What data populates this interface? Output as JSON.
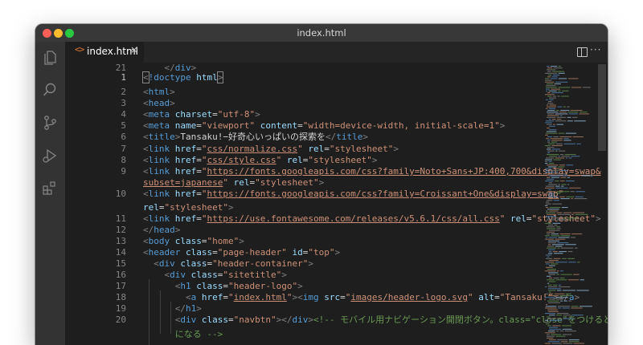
{
  "window": {
    "title": "index.html"
  },
  "tab": {
    "icon": "<>",
    "label": "index.html",
    "close": "×"
  },
  "toolbar": {
    "more": "···"
  },
  "activity": [
    "files-icon",
    "search-icon",
    "source-control-icon",
    "run-debug-icon",
    "extensions-icon"
  ],
  "lines": [
    {
      "n": "1",
      "html": "<span class=\"g cursorbox\">&lt;</span><span class=\"t\">!doctype</span> <span class=\"a\">html</span><span class=\"g cursorbox\">&gt;</span>"
    },
    {
      "n": "2",
      "html": "<span class=\"g\">&lt;</span><span class=\"t\">html</span><span class=\"g\">&gt;</span>"
    },
    {
      "n": "3",
      "html": "<span class=\"g\">&lt;</span><span class=\"t\">head</span><span class=\"g\">&gt;</span>"
    },
    {
      "n": "4",
      "html": "<span class=\"g\">&lt;</span><span class=\"t\">meta</span> <span class=\"a\">charset</span>=<span class=\"s\">\"utf-8\"</span><span class=\"g\">&gt;</span>"
    },
    {
      "n": "5",
      "html": "<span class=\"g\">&lt;</span><span class=\"t\">meta</span> <span class=\"a\">name</span>=<span class=\"s\">\"viewport\"</span> <span class=\"a\">content</span>=<span class=\"s\">\"width=device-width, initial-scale=1\"</span><span class=\"g\">&gt;</span>"
    },
    {
      "n": "6",
      "html": "<span class=\"g\">&lt;</span><span class=\"t\">title</span><span class=\"g\">&gt;</span><span class=\"x\">Tansaku!−好奇心いっぱいの探索を</span><span class=\"g\">&lt;/</span><span class=\"t\">title</span><span class=\"g\">&gt;</span>"
    },
    {
      "n": "7",
      "html": "<span class=\"g\">&lt;</span><span class=\"t\">link</span> <span class=\"a\">href</span>=<span class=\"s\">\"<span class=\"u\">css/normalize.css</span>\"</span> <span class=\"a\">rel</span>=<span class=\"s\">\"stylesheet\"</span><span class=\"g\">&gt;</span>"
    },
    {
      "n": "8",
      "html": "<span class=\"g\">&lt;</span><span class=\"t\">link</span> <span class=\"a\">href</span>=<span class=\"s\">\"<span class=\"u\">css/style.css</span>\"</span> <span class=\"a\">rel</span>=<span class=\"s\">\"stylesheet\"</span><span class=\"g\">&gt;</span>"
    },
    {
      "n": "9",
      "html": "<span class=\"g\">&lt;</span><span class=\"t\">link</span> <span class=\"a\">href</span>=<span class=\"s\">\"<span class=\"u\">https://fonts.googleapis.com/css?family=Noto+Sans+JP:400,700&amp;display=swap&amp;</span></span>"
    },
    {
      "n": "",
      "html": "<span class=\"s\"><span class=\"u\">subset=japanese</span>\"</span> <span class=\"a\">rel</span>=<span class=\"s\">\"stylesheet\"</span><span class=\"g\">&gt;</span>"
    },
    {
      "n": "10",
      "html": "<span class=\"g\">&lt;</span><span class=\"t\">link</span> <span class=\"a\">href</span>=<span class=\"s\">\"<span class=\"u\">https://fonts.googleapis.com/css?family=Croissant+One&amp;display=swap</span>\"</span>"
    },
    {
      "n": "",
      "html": "<span class=\"a\">rel</span>=<span class=\"s\">\"stylesheet\"</span><span class=\"g\">&gt;</span>"
    },
    {
      "n": "11",
      "html": "<span class=\"g\">&lt;</span><span class=\"t\">link</span> <span class=\"a\">href</span>=<span class=\"s\">\"<span class=\"u\">https://use.fontawesome.com/releases/v5.6.1/css/all.css</span>\"</span> <span class=\"a\">rel</span>=<span class=\"s\">\"stylesheet\"</span><span class=\"g\">&gt;</span>"
    },
    {
      "n": "12",
      "html": "<span class=\"g\">&lt;/</span><span class=\"t\">head</span><span class=\"g\">&gt;</span>"
    },
    {
      "n": "13",
      "html": "<span class=\"g\">&lt;</span><span class=\"t\">body</span> <span class=\"a\">class</span>=<span class=\"s\">\"home\"</span><span class=\"g\">&gt;</span>"
    },
    {
      "n": "14",
      "html": "<span class=\"g\">&lt;</span><span class=\"t\">header</span> <span class=\"a\">class</span>=<span class=\"s\">\"page-header\"</span> <span class=\"a\">id</span>=<span class=\"s\">\"top\"</span><span class=\"g\">&gt;</span>"
    },
    {
      "n": "15",
      "html": "  <span class=\"g\">&lt;</span><span class=\"t\">div</span> <span class=\"a\">class</span>=<span class=\"s\">\"header-container\"</span><span class=\"g\">&gt;</span>"
    },
    {
      "n": "16",
      "html": "    <span class=\"g\">&lt;</span><span class=\"t\">div</span> <span class=\"a\">class</span>=<span class=\"s\">\"sitetitle\"</span><span class=\"g\">&gt;</span>"
    },
    {
      "n": "17",
      "html": "      <span class=\"g\">&lt;</span><span class=\"t\">h1</span> <span class=\"a\">class</span>=<span class=\"s\">\"header-logo\"</span><span class=\"g\">&gt;</span>"
    },
    {
      "n": "18",
      "html": "        <span class=\"g\">&lt;</span><span class=\"t\">a</span> <span class=\"a\">href</span>=<span class=\"s\">\"<span class=\"u\">index.html</span>\"</span><span class=\"g\">&gt;&lt;</span><span class=\"t\">img</span> <span class=\"a\">src</span>=<span class=\"s\">\"<span class=\"u\">images/header-logo.svg</span>\"</span> <span class=\"a\">alt</span>=<span class=\"s\">\"Tansaku!\"</span><span class=\"g\">&gt;&lt;/</span><span class=\"t\">a</span><span class=\"g\">&gt;</span>"
    },
    {
      "n": "19",
      "html": "      <span class=\"g\">&lt;/</span><span class=\"t\">h1</span><span class=\"g\">&gt;</span>"
    },
    {
      "n": "20",
      "html": "      <span class=\"g\">&lt;</span><span class=\"t\">div</span> <span class=\"a\">class</span>=<span class=\"s\">\"navbtn\"</span><span class=\"g\">&gt;&lt;/</span><span class=\"t\">div</span><span class=\"g\">&gt;</span><span class=\"c\">&lt;!-- モバイル用ナビゲーション開閉ボタン。class=\"close\"をつけるとバツ</span>"
    },
    {
      "n": "",
      "html": "      <span class=\"c\">になる --&gt;</span>"
    },
    {
      "n": "21",
      "html": "    <span class=\"g\">&lt;/</span><span class=\"t\">div</span><span class=\"g\">&gt;</span>"
    }
  ]
}
